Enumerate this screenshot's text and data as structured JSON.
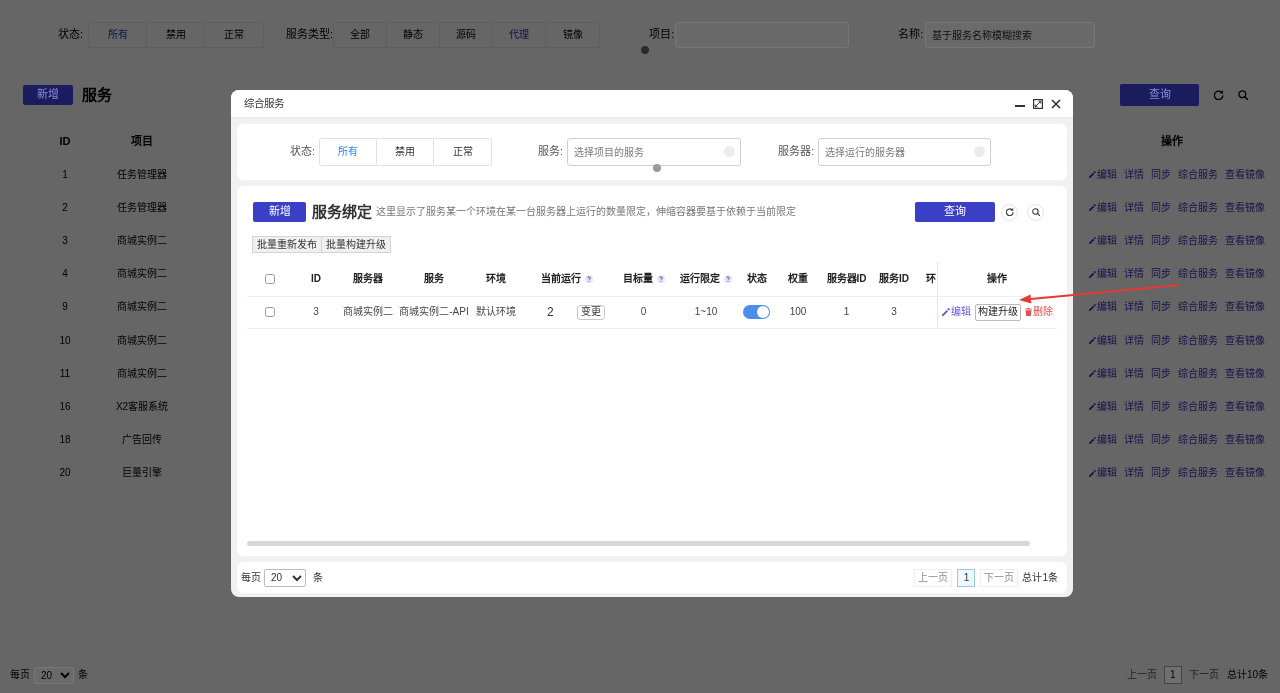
{
  "background": {
    "filter": {
      "status_label": "状态:",
      "status_options": [
        {
          "label": "所有",
          "selected": true
        },
        {
          "label": "禁用",
          "selected": false
        },
        {
          "label": "正常",
          "selected": false
        }
      ],
      "type_label": "服务类型:",
      "type_options": [
        {
          "label": "全部",
          "selected": false
        },
        {
          "label": "静态",
          "selected": false
        },
        {
          "label": "源码",
          "selected": false
        },
        {
          "label": "代理",
          "selected": true
        },
        {
          "label": "镜像",
          "selected": false
        }
      ],
      "project_label": "项目:",
      "name_label": "名称:",
      "name_placeholder": "基于服务名称模糊搜索"
    },
    "toolbar": {
      "add_button": "新增",
      "title": "服务",
      "query_button": "查询"
    },
    "table": {
      "columns": [
        "ID",
        "项目"
      ],
      "action_column": "操作",
      "rows": [
        {
          "id": "1",
          "project": "任务管理器",
          "actions": [
            {
              "kind": "edit",
              "label": "编辑"
            },
            {
              "kind": "link",
              "label": "详情"
            },
            {
              "kind": "link",
              "label": "同步"
            },
            {
              "kind": "link",
              "label": "综合服务"
            },
            {
              "kind": "link",
              "label": "查看镜像"
            }
          ]
        },
        {
          "id": "2",
          "project": "任务管理器",
          "actions": [
            {
              "kind": "edit",
              "label": "编辑"
            },
            {
              "kind": "link",
              "label": "详情"
            },
            {
              "kind": "link",
              "label": "同步"
            },
            {
              "kind": "link",
              "label": "综合服务"
            },
            {
              "kind": "link",
              "label": "查看镜像"
            }
          ]
        },
        {
          "id": "3",
          "project": "商城实例二",
          "actions": [
            {
              "kind": "edit",
              "label": "编辑"
            },
            {
              "kind": "link",
              "label": "详情"
            },
            {
              "kind": "link",
              "label": "同步"
            },
            {
              "kind": "link",
              "label": "综合服务"
            },
            {
              "kind": "link",
              "label": "查看镜像"
            }
          ]
        },
        {
          "id": "4",
          "project": "商城实例二",
          "actions": [
            {
              "kind": "edit",
              "label": "编辑"
            },
            {
              "kind": "link",
              "label": "详情"
            },
            {
              "kind": "link",
              "label": "同步"
            },
            {
              "kind": "link",
              "label": "综合服务"
            },
            {
              "kind": "link",
              "label": "查看镜像"
            }
          ]
        },
        {
          "id": "9",
          "project": "商城实例二",
          "actions": [
            {
              "kind": "edit",
              "label": "编辑"
            },
            {
              "kind": "link",
              "label": "详情"
            },
            {
              "kind": "link",
              "label": "同步"
            },
            {
              "kind": "link",
              "label": "综合服务"
            },
            {
              "kind": "link",
              "label": "查看镜像"
            }
          ]
        },
        {
          "id": "10",
          "project": "商城实例二",
          "actions": [
            {
              "kind": "edit",
              "label": "编辑"
            },
            {
              "kind": "link",
              "label": "详情"
            },
            {
              "kind": "link",
              "label": "同步"
            },
            {
              "kind": "link",
              "label": "综合服务"
            },
            {
              "kind": "link",
              "label": "查看镜像"
            }
          ]
        },
        {
          "id": "11",
          "project": "商城实例二",
          "actions": [
            {
              "kind": "edit",
              "label": "编辑"
            },
            {
              "kind": "link",
              "label": "详情"
            },
            {
              "kind": "link",
              "label": "同步"
            },
            {
              "kind": "link",
              "label": "综合服务"
            },
            {
              "kind": "link",
              "label": "查看镜像"
            }
          ]
        },
        {
          "id": "16",
          "project": "X2客服系统",
          "actions": [
            {
              "kind": "edit",
              "label": "编辑"
            },
            {
              "kind": "link",
              "label": "详情"
            },
            {
              "kind": "link",
              "label": "同步"
            },
            {
              "kind": "link",
              "label": "综合服务"
            },
            {
              "kind": "link",
              "label": "查看镜像"
            }
          ]
        },
        {
          "id": "18",
          "project": "广告回传",
          "actions": [
            {
              "kind": "edit",
              "label": "编辑"
            },
            {
              "kind": "link",
              "label": "详情"
            },
            {
              "kind": "link",
              "label": "同步"
            },
            {
              "kind": "link",
              "label": "综合服务"
            },
            {
              "kind": "link",
              "label": "查看镜像"
            }
          ]
        },
        {
          "id": "20",
          "project": "巨量引擎",
          "actions": [
            {
              "kind": "edit",
              "label": "编辑"
            },
            {
              "kind": "link",
              "label": "详情"
            },
            {
              "kind": "link",
              "label": "同步"
            },
            {
              "kind": "link",
              "label": "综合服务"
            },
            {
              "kind": "link",
              "label": "查看镜像"
            }
          ]
        }
      ]
    },
    "pagination": {
      "per_page_label": "每页",
      "per_page": "20",
      "unit": "条",
      "prev": {
        "label": "上一页",
        "disabled": true
      },
      "pages": [
        {
          "label": "1",
          "selected": true
        }
      ],
      "next": {
        "label": "下一页",
        "disabled": true
      },
      "total": "总计10条"
    }
  },
  "dialog": {
    "title": "综合服务",
    "filter": {
      "status_label": "状态:",
      "status_options": [
        {
          "label": "所有",
          "selected": true
        },
        {
          "label": "禁用",
          "selected": false
        },
        {
          "label": "正常",
          "selected": false
        }
      ],
      "service_label": "服务:",
      "service_placeholder": "选择项目的服务",
      "server_label": "服务器:",
      "server_placeholder": "选择运行的服务器"
    },
    "toolbar": {
      "add_button": "新增",
      "title": "服务绑定",
      "description": "这里显示了服务某一个环境在某一台服务器上运行的数量限定，伸缩容器要基于依赖于当前限定",
      "query_button": "查询"
    },
    "batch_buttons": [
      "批量重新发布",
      "批量构建升级"
    ],
    "table": {
      "select_all": {
        "checked": false
      },
      "columns": [
        {
          "label": "ID",
          "help": false
        },
        {
          "label": "服务器",
          "help": false
        },
        {
          "label": "服务",
          "help": false
        },
        {
          "label": "环境",
          "help": false
        },
        {
          "label": "当前运行",
          "help": true
        },
        {
          "label": "目标量",
          "help": true
        },
        {
          "label": "运行限定",
          "help": true
        },
        {
          "label": "状态",
          "help": false
        },
        {
          "label": "权重",
          "help": false
        },
        {
          "label": "服务器ID",
          "help": false
        },
        {
          "label": "服务ID",
          "help": false
        },
        {
          "label": "环",
          "help": false
        }
      ],
      "action_column": "操作",
      "rows": [
        {
          "checked": false,
          "cells": [
            {
              "kind": "text",
              "text": "3"
            },
            {
              "kind": "text",
              "text": "商城实例二"
            },
            {
              "kind": "text",
              "text": "商城实例二-API"
            },
            {
              "kind": "text",
              "text": "默认环境"
            },
            {
              "kind": "running",
              "text": "2",
              "button": "变更"
            },
            {
              "kind": "text",
              "text": "0"
            },
            {
              "kind": "text",
              "text": "1~10"
            },
            {
              "kind": "switch",
              "on": true
            },
            {
              "kind": "text",
              "text": "100"
            },
            {
              "kind": "text",
              "text": "1"
            },
            {
              "kind": "text",
              "text": "3"
            }
          ],
          "actions": [
            {
              "kind": "edit",
              "label": "编辑"
            },
            {
              "kind": "button",
              "label": "构建升级"
            },
            {
              "kind": "delete",
              "label": "删除"
            }
          ]
        }
      ]
    },
    "pagination": {
      "per_page_label": "每页",
      "per_page": "20",
      "unit": "条",
      "prev": {
        "label": "上一页",
        "disabled": true
      },
      "pages": [
        {
          "label": "1",
          "selected": true
        }
      ],
      "next": {
        "label": "下一页",
        "disabled": true
      },
      "total": "总计1条"
    }
  }
}
